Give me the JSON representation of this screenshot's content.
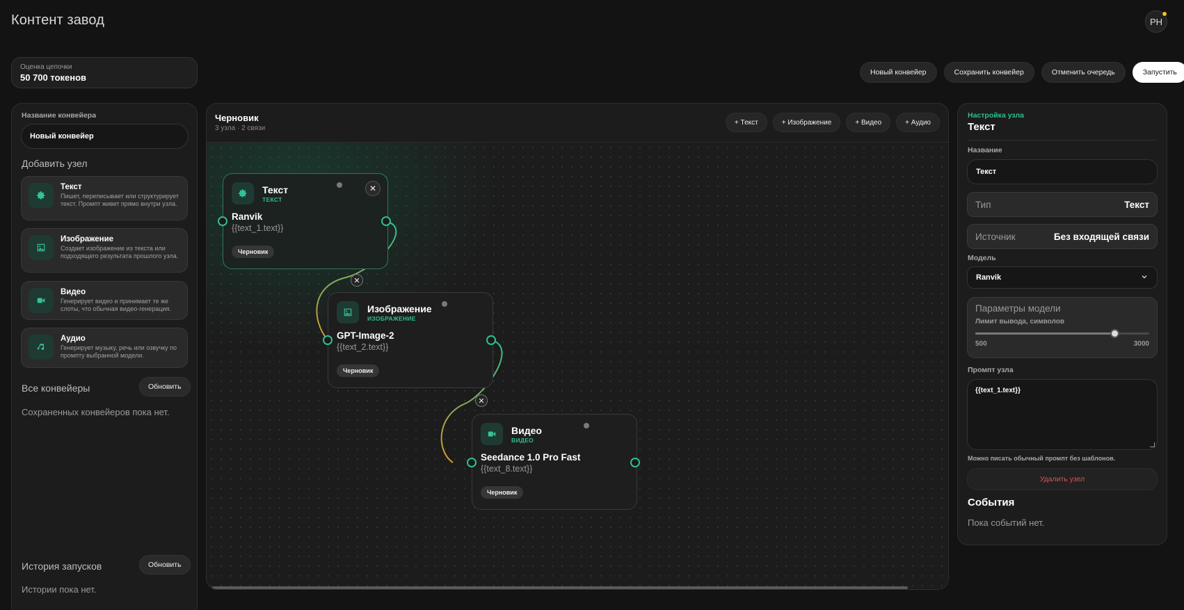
{
  "app": {
    "title": "Контент завод",
    "avatar_initials": "PH"
  },
  "estimate": {
    "label": "Оценка цепочки",
    "value": "50 700 токенов"
  },
  "toolbar": {
    "new_pipeline": "Новый конвейер",
    "save_pipeline": "Сохранить конвейер",
    "cancel_queue": "Отменить очередь",
    "run": "Запустить"
  },
  "left_panel": {
    "name_label": "Название конвейера",
    "name_value": "Новый конвейер",
    "add_node_title": "Добавить узел",
    "node_types": [
      {
        "title": "Текст",
        "desc": "Пишет, переписывает или структурирует текст. Промпт живет прямо внутри узла.",
        "icon": "gear-icon"
      },
      {
        "title": "Изображение",
        "desc": "Создает изображение из текста или подходящего результата прошлого узла.",
        "icon": "image-icon"
      },
      {
        "title": "Видео",
        "desc": "Генерирует видео и принимает те же слоты, что обычная видео-генерация.",
        "icon": "video-icon"
      },
      {
        "title": "Аудио",
        "desc": "Генерирует музыку, речь или озвучку по промпту выбранной модели.",
        "icon": "music-icon"
      }
    ],
    "all_pipelines_title": "Все конвейеры",
    "refresh_label": "Обновить",
    "no_pipelines": "Сохраненных конвейеров пока нет.",
    "history_title": "История запусков",
    "history_refresh_label": "Обновить",
    "no_history": "Истории пока нет."
  },
  "canvas": {
    "title": "Черновик",
    "subtitle": "3 узла · 2 связи",
    "add_text": "+ Текст",
    "add_image": "+ Изображение",
    "add_video": "+ Видео",
    "add_audio": "+ Аудио",
    "nodes": [
      {
        "title": "Текст",
        "type": "ТЕКСТ",
        "model": "Ranvik",
        "template": "{{text_1.text}}",
        "status": "Черновик"
      },
      {
        "title": "Изображение",
        "type": "ИЗОБРАЖЕНИЕ",
        "model": "GPT-Image-2",
        "template": "{{text_2.text}}",
        "status": "Черновик"
      },
      {
        "title": "Видео",
        "type": "ВИДЕО",
        "model": "Seedance 1.0 Pro Fast",
        "template": "{{text_8.text}}",
        "status": "Черновик"
      }
    ]
  },
  "right_panel": {
    "kicker": "Настройка узла",
    "title": "Текст",
    "name_label": "Название",
    "name_value": "Текст",
    "type_key": "Тип",
    "type_value": "Текст",
    "source_key": "Источник",
    "source_value": "Без входящей связи",
    "model_label": "Модель",
    "model_value": "Ranvik",
    "params_title": "Параметры модели",
    "limit_label": "Лимит вывода, символов",
    "limit_min": "500",
    "limit_max": "3000",
    "limit_fraction": 0.8,
    "prompt_label": "Промпт узла",
    "prompt_value": "{{text_1.text}}",
    "prompt_hint": "Можно писать обычный промпт без шаблонов.",
    "delete_label": "Удалить узел",
    "events_title": "События",
    "no_events": "Пока событий нет."
  },
  "colors": {
    "accent": "#2fbf8f",
    "danger": "#e05252",
    "background": "#131313"
  }
}
